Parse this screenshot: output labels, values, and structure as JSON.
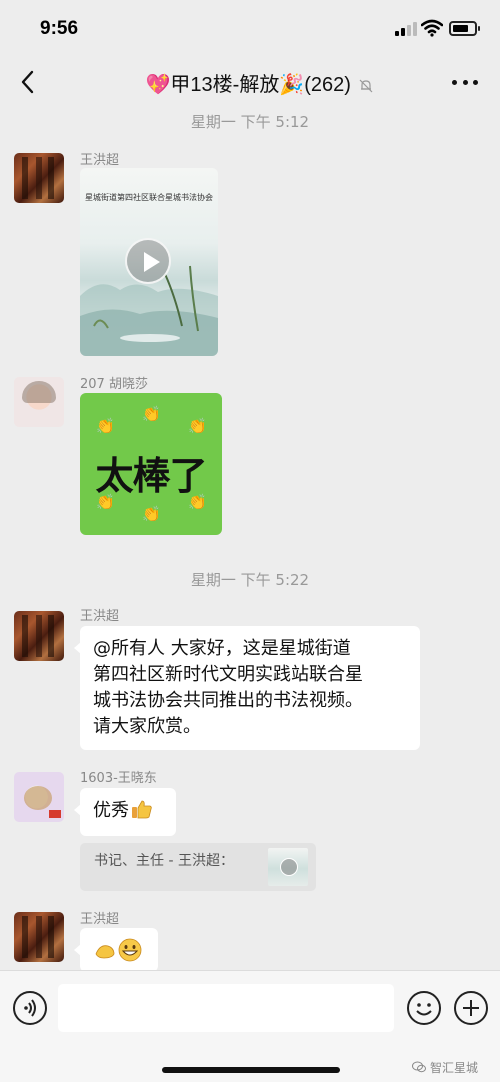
{
  "status_bar": {
    "time": "9:56",
    "battery_level": 0.75
  },
  "header": {
    "title": "💖甲13楼-解放🎉(262)",
    "back_icon": "chevron-left-icon",
    "mute_icon": "bell-slash-icon",
    "more_icon": "more-horizontal-icon"
  },
  "messages": [
    {
      "type": "time",
      "text": "星期一 下午 5:12"
    },
    {
      "type": "video",
      "sender": "王洪超",
      "caption": "星城街道第四社区联合星城书法协会"
    },
    {
      "type": "sticker",
      "sender": "207 胡晓莎",
      "text": "太棒了"
    },
    {
      "type": "time",
      "text": "星期一 下午 5:22"
    },
    {
      "type": "text",
      "sender": "王洪超",
      "lines": [
        "@所有人 大家好，这是星城街道",
        "第四社区新时代文明实践站联合星",
        "城书法协会共同推出的书法视频。",
        "请大家欣赏。"
      ]
    },
    {
      "type": "text",
      "sender": "1603-王晓东",
      "text": "优秀",
      "emoji": "thumbs-up-icon"
    },
    {
      "type": "quote",
      "text": "书记、主任 - 王洪超："
    },
    {
      "type": "emoji",
      "sender": "王洪超",
      "emojis": [
        "fist-icon",
        "grinning-face-icon"
      ]
    }
  ],
  "input_bar": {
    "voice_icon": "voice-icon",
    "emoji_icon": "smile-icon",
    "plus_icon": "plus-icon"
  },
  "watermark": {
    "text": "智汇星城"
  },
  "colors": {
    "background": "#ededed",
    "sticker_green": "#72c94a",
    "bubble": "#ffffff"
  }
}
